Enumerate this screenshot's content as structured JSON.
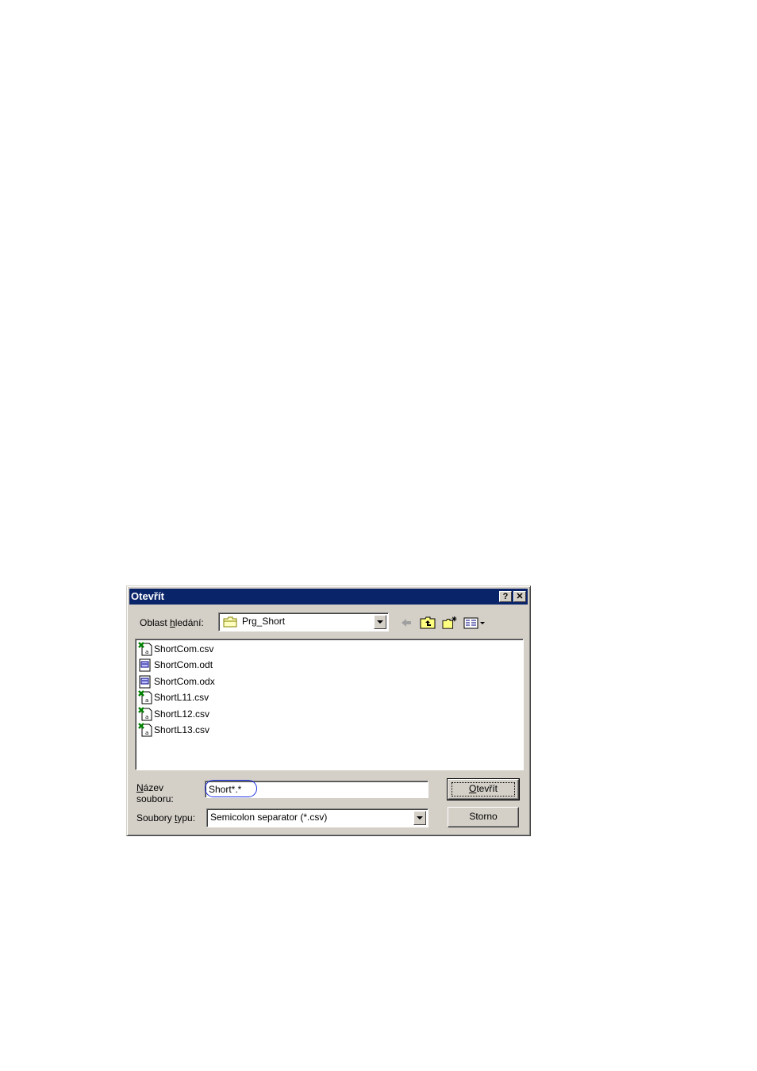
{
  "dialog": {
    "title": "Otevřít",
    "help_label": "?",
    "close_label": "✕"
  },
  "lookin": {
    "label_pre": "Oblast ",
    "label_accel": "h",
    "label_post": "ledání:",
    "value": "Prg_Short"
  },
  "toolbar": {
    "icons": [
      "back-arrow-icon",
      "up-folder-icon",
      "new-folder-icon",
      "view-menu-icon"
    ]
  },
  "files": [
    {
      "name": "ShortCom.csv",
      "icon": "excel-csv-icon"
    },
    {
      "name": "ShortCom.odt",
      "icon": "document-icon"
    },
    {
      "name": "ShortCom.odx",
      "icon": "document-icon"
    },
    {
      "name": "ShortL11.csv",
      "icon": "excel-csv-icon"
    },
    {
      "name": "ShortL12.csv",
      "icon": "excel-csv-icon"
    },
    {
      "name": "ShortL13.csv",
      "icon": "excel-csv-icon"
    }
  ],
  "filename": {
    "label_accel": "N",
    "label_line1_post": "ázev",
    "label_line2": "souboru:",
    "value": "Short*.*"
  },
  "filetype": {
    "label_pre": "Soubory ",
    "label_accel": "t",
    "label_post": "ypu:",
    "value": "Semicolon separator (*.csv)"
  },
  "buttons": {
    "open_accel": "O",
    "open_post": "tevřít",
    "cancel": "Storno"
  },
  "colors": {
    "titlebar": "#0a246a",
    "face": "#d4d0c8",
    "highlight_oval": "#1a2ee0"
  }
}
